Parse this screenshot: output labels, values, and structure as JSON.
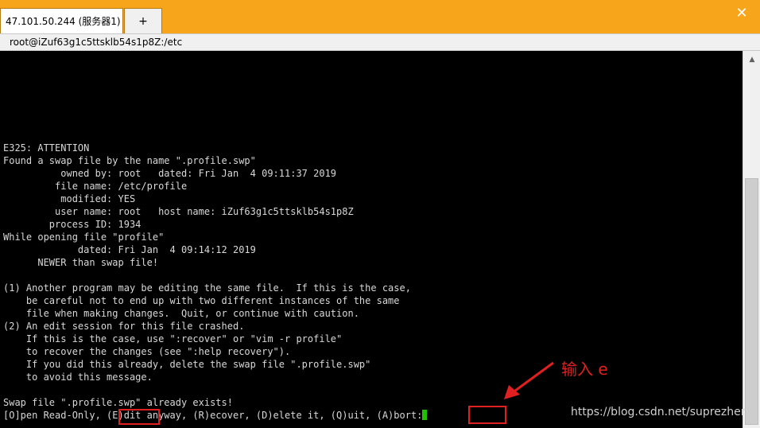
{
  "tabs": [
    {
      "label": "47.101.50.244 (服务器1)"
    },
    {
      "label": "+"
    }
  ],
  "window": {
    "close_glyph": "✕",
    "title": "root@iZuf63g1c5ttsklb54s1p8Z:/etc"
  },
  "terminal": {
    "lines": [
      "E325: ATTENTION",
      "Found a swap file by the name \".profile.swp\"",
      "          owned by: root   dated: Fri Jan  4 09:11:37 2019",
      "         file name: /etc/profile",
      "          modified: YES",
      "         user name: root   host name: iZuf63g1c5ttsklb54s1p8Z",
      "        process ID: 1934",
      "While opening file \"profile\"",
      "             dated: Fri Jan  4 09:14:12 2019",
      "      NEWER than swap file!",
      "",
      "(1) Another program may be editing the same file.  If this is the case,",
      "    be careful not to end up with two different instances of the same",
      "    file when making changes.  Quit, or continue with caution.",
      "(2) An edit session for this file crashed.",
      "    If this is the case, use \":recover\" or \"vim -r profile\"",
      "    to recover the changes (see \":help recovery\").",
      "    If you did this already, delete the swap file \".profile.swp\"",
      "    to avoid this message.",
      "",
      "Swap file \".profile.swp\" already exists!",
      "[O]pen Read-Only, (E)dit anyway, (R)ecover, (D)elete it, (Q)uit, (A)bort:"
    ]
  },
  "annotation": {
    "text": "输入 e"
  },
  "watermark": "https://blog.csdn.net/suprezher",
  "colors": {
    "window_frame": "#f7a51b",
    "terminal_bg": "#000000",
    "terminal_fg": "#d8d8d8",
    "cursor": "#22c000",
    "annotation": "#e02020"
  },
  "icons": {
    "close": "close-icon",
    "scroll_up": "chevron-up-icon"
  }
}
